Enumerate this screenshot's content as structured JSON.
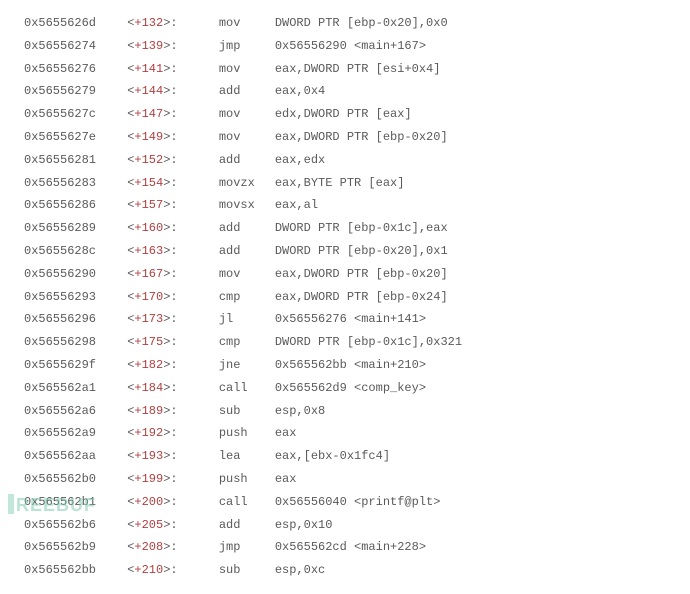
{
  "rows": [
    {
      "addr": "0x5655626d",
      "offset": "+132",
      "mnem": "mov",
      "operand": "DWORD PTR [ebp-0x20],0x0"
    },
    {
      "addr": "0x56556274",
      "offset": "+139",
      "mnem": "jmp",
      "operand": "0x56556290 <main+167>"
    },
    {
      "addr": "0x56556276",
      "offset": "+141",
      "mnem": "mov",
      "operand": "eax,DWORD PTR [esi+0x4]"
    },
    {
      "addr": "0x56556279",
      "offset": "+144",
      "mnem": "add",
      "operand": "eax,0x4"
    },
    {
      "addr": "0x5655627c",
      "offset": "+147",
      "mnem": "mov",
      "operand": "edx,DWORD PTR [eax]"
    },
    {
      "addr": "0x5655627e",
      "offset": "+149",
      "mnem": "mov",
      "operand": "eax,DWORD PTR [ebp-0x20]"
    },
    {
      "addr": "0x56556281",
      "offset": "+152",
      "mnem": "add",
      "operand": "eax,edx"
    },
    {
      "addr": "0x56556283",
      "offset": "+154",
      "mnem": "movzx",
      "operand": "eax,BYTE PTR [eax]"
    },
    {
      "addr": "0x56556286",
      "offset": "+157",
      "mnem": "movsx",
      "operand": "eax,al"
    },
    {
      "addr": "0x56556289",
      "offset": "+160",
      "mnem": "add",
      "operand": "DWORD PTR [ebp-0x1c],eax"
    },
    {
      "addr": "0x5655628c",
      "offset": "+163",
      "mnem": "add",
      "operand": "DWORD PTR [ebp-0x20],0x1"
    },
    {
      "addr": "0x56556290",
      "offset": "+167",
      "mnem": "mov",
      "operand": "eax,DWORD PTR [ebp-0x20]"
    },
    {
      "addr": "0x56556293",
      "offset": "+170",
      "mnem": "cmp",
      "operand": "eax,DWORD PTR [ebp-0x24]"
    },
    {
      "addr": "0x56556296",
      "offset": "+173",
      "mnem": "jl",
      "operand": "0x56556276 <main+141>"
    },
    {
      "addr": "0x56556298",
      "offset": "+175",
      "mnem": "cmp",
      "operand": "DWORD PTR [ebp-0x1c],0x321"
    },
    {
      "addr": "0x5655629f",
      "offset": "+182",
      "mnem": "jne",
      "operand": "0x565562bb <main+210>"
    },
    {
      "addr": "0x565562a1",
      "offset": "+184",
      "mnem": "call",
      "operand": "0x565562d9 <comp_key>"
    },
    {
      "addr": "0x565562a6",
      "offset": "+189",
      "mnem": "sub",
      "operand": "esp,0x8"
    },
    {
      "addr": "0x565562a9",
      "offset": "+192",
      "mnem": "push",
      "operand": "eax"
    },
    {
      "addr": "0x565562aa",
      "offset": "+193",
      "mnem": "lea",
      "operand": "eax,[ebx-0x1fc4]"
    },
    {
      "addr": "0x565562b0",
      "offset": "+199",
      "mnem": "push",
      "operand": "eax"
    },
    {
      "addr": "0x565562b1",
      "offset": "+200",
      "mnem": "call",
      "operand": "0x56556040 <printf@plt>"
    },
    {
      "addr": "0x565562b6",
      "offset": "+205",
      "mnem": "add",
      "operand": "esp,0x10"
    },
    {
      "addr": "0x565562b9",
      "offset": "+208",
      "mnem": "jmp",
      "operand": "0x565562cd <main+228>"
    },
    {
      "addr": "0x565562bb",
      "offset": "+210",
      "mnem": "sub",
      "operand": "esp,0xc"
    }
  ],
  "watermark": "REEBUF"
}
